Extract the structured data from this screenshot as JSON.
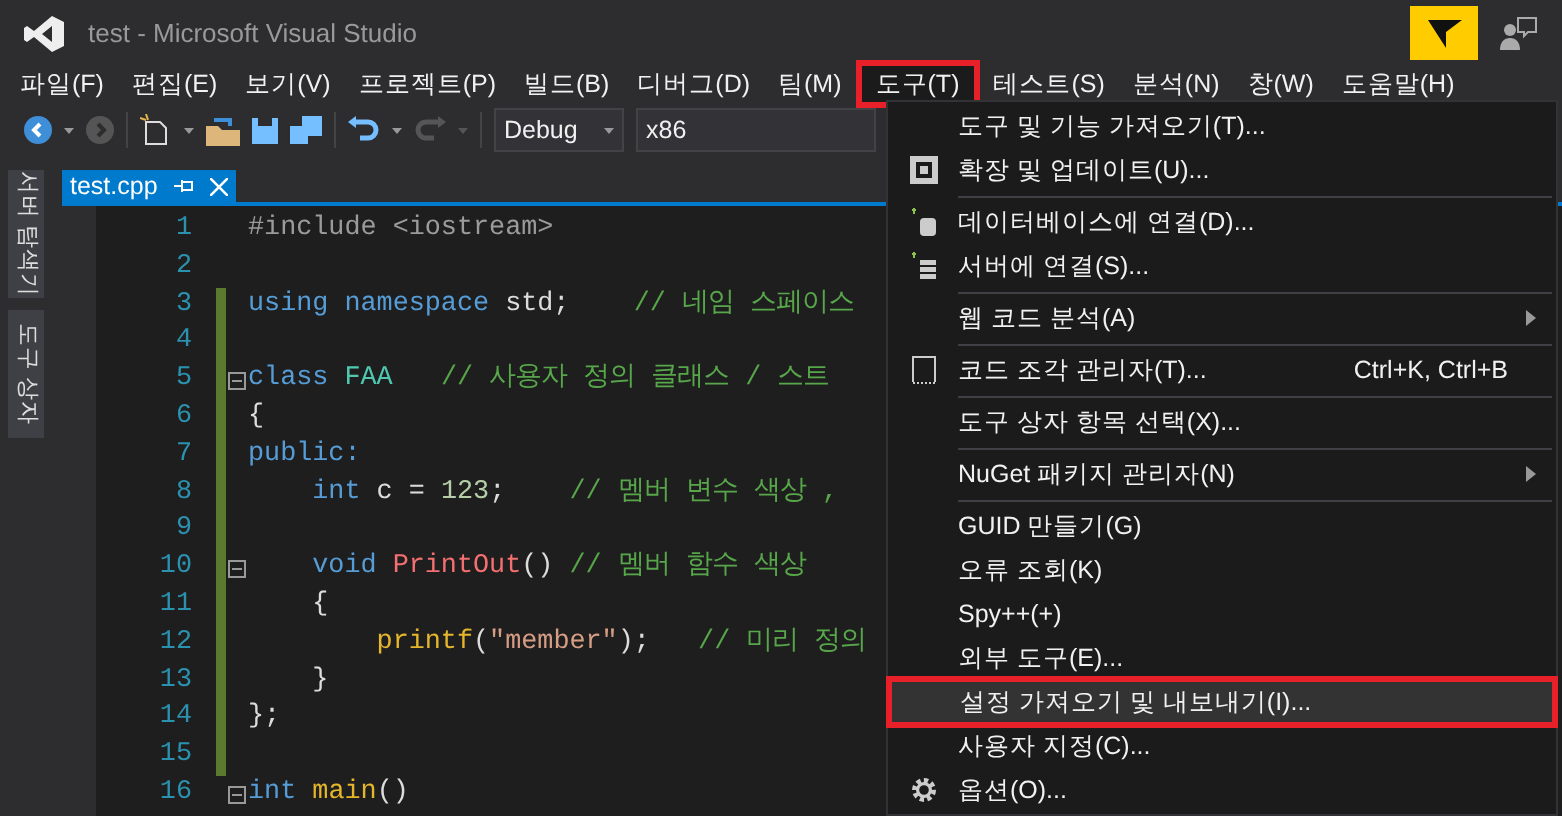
{
  "window": {
    "title": "test - Microsoft Visual Studio"
  },
  "menu_bar": [
    {
      "label": "파일(F)",
      "selected": false
    },
    {
      "label": "편집(E)",
      "selected": false
    },
    {
      "label": "보기(V)",
      "selected": false
    },
    {
      "label": "프로젝트(P)",
      "selected": false
    },
    {
      "label": "빌드(B)",
      "selected": false
    },
    {
      "label": "디버그(D)",
      "selected": false
    },
    {
      "label": "팀(M)",
      "selected": false
    },
    {
      "label": "도구(T)",
      "selected": true
    },
    {
      "label": "테스트(S)",
      "selected": false
    },
    {
      "label": "분석(N)",
      "selected": false
    },
    {
      "label": "창(W)",
      "selected": false
    },
    {
      "label": "도움말(H)",
      "selected": false
    }
  ],
  "toolbar": {
    "configuration": "Debug",
    "platform": "x86"
  },
  "side_tabs": [
    "서버 탐색기",
    "도구 상자"
  ],
  "editor_tabs": [
    {
      "label": "test.cpp",
      "selected": true
    }
  ],
  "code_lines": [
    {
      "number": "1",
      "fold": false,
      "changed": false,
      "tokens": [
        {
          "kind": "preproc",
          "text": "#include <iostream>"
        }
      ]
    },
    {
      "number": "2",
      "fold": false,
      "changed": false
    },
    {
      "number": "3",
      "fold": false,
      "changed": true,
      "tokens": [
        {
          "kind": "keyword",
          "text": "using namespace "
        },
        {
          "kind": "plain",
          "text": "std;    "
        },
        {
          "kind": "comment",
          "text": "// 네임 스페이스"
        }
      ]
    },
    {
      "number": "4",
      "fold": false,
      "changed": true
    },
    {
      "number": "5",
      "fold": true,
      "changed": true,
      "tokens": [
        {
          "kind": "keyword",
          "text": "class "
        },
        {
          "kind": "type",
          "text": "FAA   "
        },
        {
          "kind": "comment",
          "text": "// 사용자 정의 클래스 / 스트"
        }
      ]
    },
    {
      "number": "6",
      "fold": false,
      "changed": true,
      "tokens": [
        {
          "kind": "plain",
          "text": "{"
        }
      ]
    },
    {
      "number": "7",
      "fold": false,
      "changed": true,
      "tokens": [
        {
          "kind": "keyword",
          "text": "public:"
        }
      ]
    },
    {
      "number": "8",
      "fold": false,
      "changed": true,
      "tokens": [
        {
          "kind": "keyword",
          "text": "    int "
        },
        {
          "kind": "plain",
          "text": "c = "
        },
        {
          "kind": "number",
          "text": "123"
        },
        {
          "kind": "plain",
          "text": ";    "
        },
        {
          "kind": "comment",
          "text": "// 멤버 변수 색상 ,"
        }
      ]
    },
    {
      "number": "9",
      "fold": false,
      "changed": true
    },
    {
      "number": "10",
      "fold": true,
      "changed": true,
      "tokens": [
        {
          "kind": "keyword",
          "text": "    void "
        },
        {
          "kind": "member",
          "text": "PrintOut"
        },
        {
          "kind": "plain",
          "text": "() "
        },
        {
          "kind": "comment",
          "text": "// 멤버 함수 색상"
        }
      ]
    },
    {
      "number": "11",
      "fold": false,
      "changed": true,
      "tokens": [
        {
          "kind": "plain",
          "text": "    {"
        }
      ]
    },
    {
      "number": "12",
      "fold": false,
      "changed": true,
      "tokens": [
        {
          "kind": "func",
          "text": "        printf"
        },
        {
          "kind": "plain",
          "text": "("
        },
        {
          "kind": "string",
          "text": "\"member\""
        },
        {
          "kind": "plain",
          "text": ");   "
        },
        {
          "kind": "comment",
          "text": "// 미리 정의"
        }
      ]
    },
    {
      "number": "13",
      "fold": false,
      "changed": true,
      "tokens": [
        {
          "kind": "plain",
          "text": "    }"
        }
      ]
    },
    {
      "number": "14",
      "fold": false,
      "changed": true,
      "tokens": [
        {
          "kind": "plain",
          "text": "};"
        }
      ]
    },
    {
      "number": "15",
      "fold": false,
      "changed": true
    },
    {
      "number": "16",
      "fold": true,
      "changed": false,
      "tokens": [
        {
          "kind": "keyword",
          "text": "int "
        },
        {
          "kind": "func",
          "text": "main"
        },
        {
          "kind": "plain",
          "text": "()"
        }
      ]
    }
  ],
  "tools_menu": [
    {
      "kind": "plain",
      "label": "도구 및 기능 가져오기(T)...",
      "highlighted": false,
      "submenu": false
    },
    {
      "kind": "extensions",
      "label": "확장 및 업데이트(U)...",
      "highlighted": false,
      "submenu": false
    },
    {
      "kind": "separator"
    },
    {
      "kind": "database",
      "label": "데이터베이스에 연결(D)...",
      "highlighted": false,
      "submenu": false
    },
    {
      "kind": "server",
      "label": "서버에 연결(S)...",
      "highlighted": false,
      "submenu": false
    },
    {
      "kind": "separator"
    },
    {
      "kind": "plain",
      "label": "웹 코드 분석(A)",
      "highlighted": false,
      "submenu": true
    },
    {
      "kind": "separator"
    },
    {
      "kind": "snippet",
      "label": "코드 조각 관리자(T)...",
      "shortcut": "Ctrl+K, Ctrl+B",
      "highlighted": false,
      "submenu": false
    },
    {
      "kind": "separator"
    },
    {
      "kind": "plain",
      "label": "도구 상자 항목 선택(X)...",
      "highlighted": false,
      "submenu": false
    },
    {
      "kind": "separator"
    },
    {
      "kind": "plain",
      "label": "NuGet 패키지 관리자(N)",
      "highlighted": false,
      "submenu": true
    },
    {
      "kind": "separator"
    },
    {
      "kind": "plain",
      "label": "GUID 만들기(G)",
      "highlighted": false,
      "submenu": false
    },
    {
      "kind": "plain",
      "label": "오류 조회(K)",
      "highlighted": false,
      "submenu": false
    },
    {
      "kind": "plain",
      "label": "Spy++(+)",
      "highlighted": false,
      "submenu": false
    },
    {
      "kind": "plain",
      "label": "외부 도구(E)...",
      "highlighted": false,
      "submenu": false
    },
    {
      "kind": "plain",
      "label": "설정 가져오기 및 내보내기(I)...",
      "highlighted": true,
      "submenu": false
    },
    {
      "kind": "plain",
      "label": "사용자 지정(C)...",
      "highlighted": false,
      "submenu": false
    },
    {
      "kind": "settings",
      "label": "옵션(O)...",
      "highlighted": false,
      "submenu": false
    }
  ]
}
